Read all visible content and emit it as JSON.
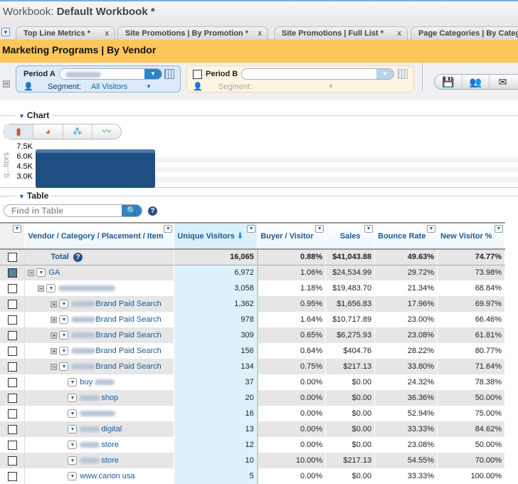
{
  "workbook": {
    "prefix": "Workbook: ",
    "name": "Default Workbook *"
  },
  "tabs": [
    {
      "label": "Top Line Metrics *"
    },
    {
      "label": "Site Promotions | By Promotion *"
    },
    {
      "label": "Site Promotions | Full List *"
    },
    {
      "label": "Page Categories | By Category"
    }
  ],
  "tab_close": "x",
  "report_title": "Marketing Programs | By Vendor",
  "period_a": {
    "label": "Period A",
    "segment_label": "Segment:",
    "segment_value": "All Visitors"
  },
  "period_b": {
    "label": "Period B",
    "segment_label": "Segment:"
  },
  "chart": {
    "section": "Chart",
    "chart_data": {
      "type": "bar",
      "ylabel": "q...itors",
      "yticks": [
        "7.5K",
        "6.0K",
        "4.5K",
        "3.0K"
      ],
      "values": [
        6972
      ],
      "color": "#1f4e82"
    }
  },
  "table_section": {
    "label": "Table",
    "find_placeholder": "Find in Table"
  },
  "columns": [
    "Vendor / Category / Placement / Item",
    "Unique Visitors",
    "Buyer / Visitor",
    "Sales",
    "Bounce Rate",
    "New Visitor %"
  ],
  "total": {
    "label": "Total",
    "uv": "16,065",
    "bv": "0.88%",
    "sales": "$41,043.88",
    "br": "49.63%",
    "nv": "74.77%"
  },
  "rows": [
    {
      "name": "GA",
      "level": 0,
      "toggle": "−",
      "checked": true,
      "uv": "6,972",
      "bv": "1.06%",
      "sales": "$24,534.99",
      "br": "29.72%",
      "nv": "73.98%"
    },
    {
      "name": "",
      "level": 1,
      "toggle": "−",
      "uv": "3,058",
      "bv": "1.18%",
      "sales": "$19,483.70",
      "br": "21.34%",
      "nv": "68.84%"
    },
    {
      "name": "Brand Paid Search",
      "level": 2,
      "toggle": "+",
      "uv": "1,362",
      "bv": "0.95%",
      "sales": "$1,656.83",
      "br": "17.96%",
      "nv": "69.97%"
    },
    {
      "name": "Brand Paid Search",
      "level": 2,
      "toggle": "+",
      "uv": "978",
      "bv": "1.64%",
      "sales": "$10,717.89",
      "br": "23.00%",
      "nv": "66.46%"
    },
    {
      "name": "Brand Paid Search",
      "level": 2,
      "toggle": "+",
      "uv": "309",
      "bv": "0.65%",
      "sales": "$6,275.93",
      "br": "23.08%",
      "nv": "61.81%"
    },
    {
      "name": "Brand Paid Search",
      "level": 2,
      "toggle": "+",
      "uv": "156",
      "bv": "0.64%",
      "sales": "$404.76",
      "br": "28.22%",
      "nv": "80.77%"
    },
    {
      "name": "Brand Paid Search",
      "level": 2,
      "toggle": "−",
      "uv": "134",
      "bv": "0.75%",
      "sales": "$217.13",
      "br": "33.80%",
      "nv": "71.64%"
    },
    {
      "name": "buy",
      "level": 3,
      "uv": "37",
      "bv": "0.00%",
      "sales": "$0.00",
      "br": "24.32%",
      "nv": "78.38%"
    },
    {
      "name": "shop",
      "level": 3,
      "uv": "20",
      "bv": "0.00%",
      "sales": "$0.00",
      "br": "36.36%",
      "nv": "50.00%"
    },
    {
      "name": "",
      "level": 3,
      "uv": "16",
      "bv": "0.00%",
      "sales": "$0.00",
      "br": "52.94%",
      "nv": "75.00%"
    },
    {
      "name": "digital",
      "level": 3,
      "uv": "13",
      "bv": "0.00%",
      "sales": "$0.00",
      "br": "33.33%",
      "nv": "84.62%"
    },
    {
      "name": "store",
      "level": 3,
      "uv": "12",
      "bv": "0.00%",
      "sales": "$0.00",
      "br": "23.08%",
      "nv": "50.00%"
    },
    {
      "name": "store",
      "level": 3,
      "uv": "10",
      "bv": "10.00%",
      "sales": "$217.13",
      "br": "54.55%",
      "nv": "70.00%"
    },
    {
      "name": "www.canon usa",
      "level": 3,
      "uv": "5",
      "bv": "0.00%",
      "sales": "$0.00",
      "br": "33.33%",
      "nv": "100.00%"
    }
  ]
}
